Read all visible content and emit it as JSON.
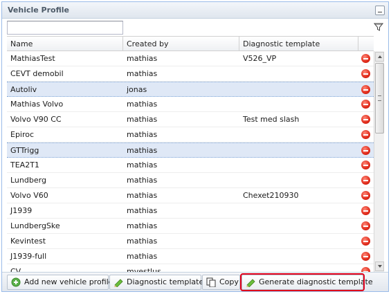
{
  "panel": {
    "title": "Vehicle Profile"
  },
  "filter": {
    "placeholder": ""
  },
  "columns": [
    "Name",
    "Created by",
    "Diagnostic template"
  ],
  "rows": [
    {
      "name": "MathiasTest",
      "created_by": "mathias",
      "template": "V526_VP",
      "selected": false
    },
    {
      "name": "CEVT demobil",
      "created_by": "mathias",
      "template": "",
      "selected": false
    },
    {
      "name": "Autoliv",
      "created_by": "jonas",
      "template": "",
      "selected": true
    },
    {
      "name": "Mathias Volvo",
      "created_by": "mathias",
      "template": "",
      "selected": false
    },
    {
      "name": "Volvo V90 CC",
      "created_by": "mathias",
      "template": "Test med slash",
      "selected": false
    },
    {
      "name": "Epiroc",
      "created_by": "mathias",
      "template": "",
      "selected": false
    },
    {
      "name": "GTTrigg",
      "created_by": "mathias",
      "template": "",
      "selected": true
    },
    {
      "name": "TEA2T1",
      "created_by": "mathias",
      "template": "",
      "selected": false
    },
    {
      "name": "Lundberg",
      "created_by": "mathias",
      "template": "",
      "selected": false
    },
    {
      "name": "Volvo V60",
      "created_by": "mathias",
      "template": "Chexet210930",
      "selected": false
    },
    {
      "name": "J1939",
      "created_by": "mathias",
      "template": "",
      "selected": false
    },
    {
      "name": "LundbergSke",
      "created_by": "mathias",
      "template": "",
      "selected": false
    },
    {
      "name": "Kevintest",
      "created_by": "mathias",
      "template": "",
      "selected": false
    },
    {
      "name": "J1939-full",
      "created_by": "mathias",
      "template": "",
      "selected": false
    },
    {
      "name": "CV",
      "created_by": "mvestlus",
      "template": "",
      "selected": false
    }
  ],
  "toolbar": {
    "add_label": "Add new vehicle profile",
    "templates_label": "Diagnostic templates",
    "copy_label": "Copy",
    "generate_label": "Generate diagnostic template"
  },
  "colors": {
    "selected_row": "#dfe8f6",
    "highlight": "#e0001b",
    "delete": "#e02a1a"
  },
  "icons": {
    "row_action": "delete-icon",
    "filter": "filter-icon",
    "add": "add-icon",
    "templates": "pencil-icon",
    "copy": "copy-icon",
    "generate": "pencil-icon"
  }
}
